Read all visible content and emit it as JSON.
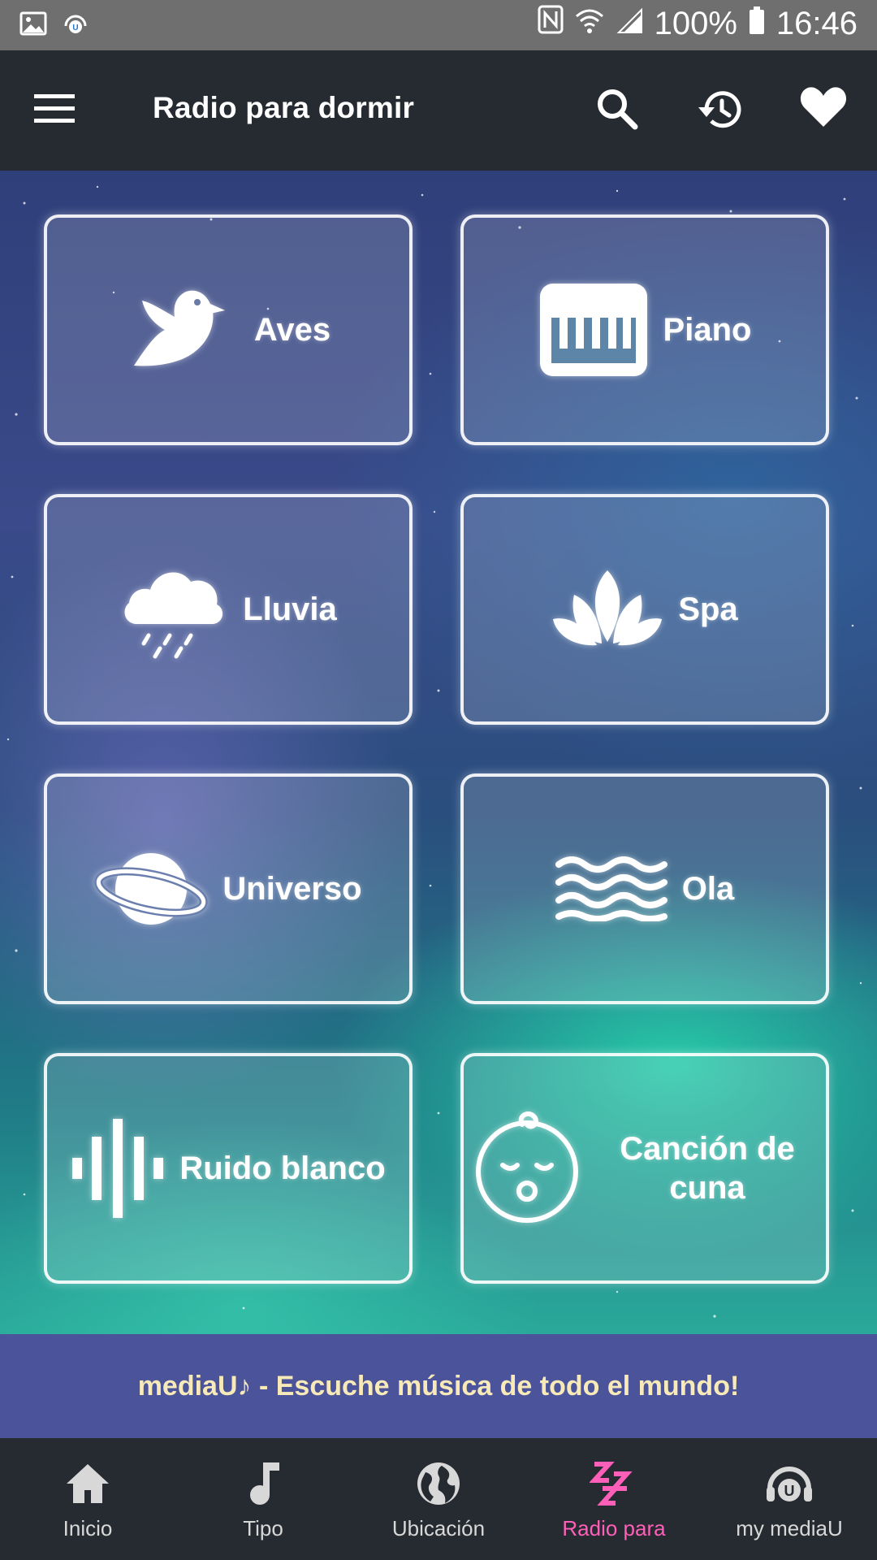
{
  "status_bar": {
    "battery": "100%",
    "time": "16:46"
  },
  "app_bar": {
    "title": "Radio para dormir",
    "icons": [
      "menu-icon",
      "search-icon",
      "history-icon",
      "heart-icon"
    ]
  },
  "tiles": [
    {
      "label": "Aves",
      "icon": "bird-icon"
    },
    {
      "label": "Piano",
      "icon": "piano-icon"
    },
    {
      "label": "Lluvia",
      "icon": "rain-cloud-icon"
    },
    {
      "label": "Spa",
      "icon": "lotus-icon"
    },
    {
      "label": "Universo",
      "icon": "planet-icon"
    },
    {
      "label": "Ola",
      "icon": "waves-icon"
    },
    {
      "label": "Ruido blanco",
      "icon": "sound-wave-icon"
    },
    {
      "label": "Canción de cuna",
      "icon": "baby-icon"
    }
  ],
  "banner": {
    "text": "mediaU♪ - Escuche música de todo el mundo!"
  },
  "bottom_nav": [
    {
      "label": "Inicio",
      "icon": "home-icon",
      "active": false
    },
    {
      "label": "Tipo",
      "icon": "music-note-icon",
      "active": false
    },
    {
      "label": "Ubicación",
      "icon": "globe-icon",
      "active": false
    },
    {
      "label": "Radio para",
      "icon": "sleep-zzz-icon",
      "active": true
    },
    {
      "label": "my mediaU",
      "icon": "headphones-icon",
      "active": false
    }
  ],
  "colors": {
    "active_nav": "#ff5fb8",
    "banner_bg": "#4b539b",
    "banner_text": "#f7e9b8",
    "bar_bg": "#262b31"
  }
}
